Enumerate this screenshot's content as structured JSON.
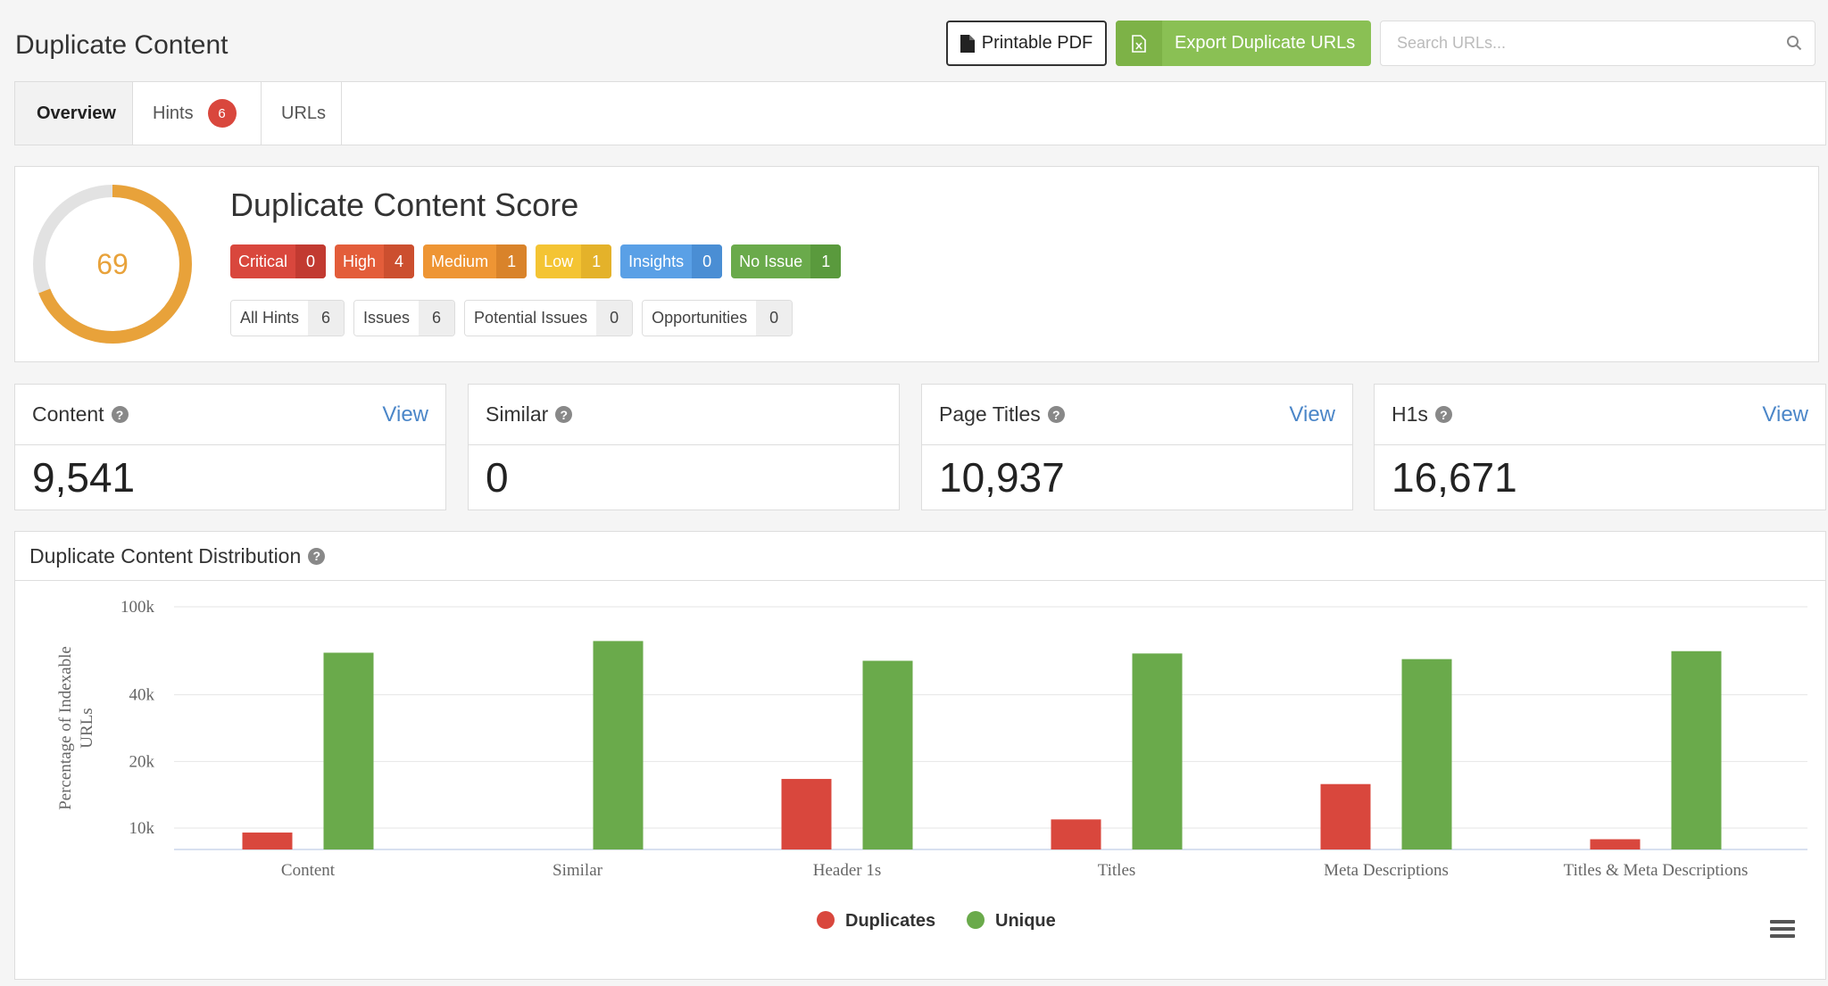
{
  "header": {
    "title": "Duplicate Content",
    "pdf_label": "Printable PDF",
    "export_label": "Export Duplicate URLs",
    "search_placeholder": "Search URLs..."
  },
  "tabs": [
    {
      "label": "Overview"
    },
    {
      "label": "Hints",
      "count": "6"
    },
    {
      "label": "URLs"
    }
  ],
  "score": {
    "title": "Duplicate Content Score",
    "value": "69",
    "fraction": 0.69,
    "ring_color": "#e8a23a",
    "severity": [
      {
        "label": "Critical",
        "count": "0",
        "color": "#d9473d",
        "count_bg": "#c23a31"
      },
      {
        "label": "High",
        "count": "4",
        "color": "#e35d3a",
        "count_bg": "#cc4f2f"
      },
      {
        "label": "Medium",
        "count": "1",
        "color": "#ee9534",
        "count_bg": "#d9832a"
      },
      {
        "label": "Low",
        "count": "1",
        "color": "#f4c433",
        "count_bg": "#e4b22a"
      },
      {
        "label": "Insights",
        "count": "0",
        "color": "#5aa0e6",
        "count_bg": "#4a8ed4"
      },
      {
        "label": "No Issue",
        "count": "1",
        "color": "#6aaa4b",
        "count_bg": "#5a9a3d"
      }
    ],
    "filters": [
      {
        "label": "All Hints",
        "count": "6"
      },
      {
        "label": "Issues",
        "count": "6"
      },
      {
        "label": "Potential Issues",
        "count": "0"
      },
      {
        "label": "Opportunities",
        "count": "0"
      }
    ]
  },
  "cards": [
    {
      "label": "Content",
      "value": "9,541",
      "view": "View"
    },
    {
      "label": "Similar",
      "value": "0",
      "view": ""
    },
    {
      "label": "Page Titles",
      "value": "10,937",
      "view": "View"
    },
    {
      "label": "H1s",
      "value": "16,671",
      "view": "View"
    }
  ],
  "distribution": {
    "title": "Duplicate Content Distribution"
  },
  "chart_data": {
    "type": "bar",
    "categories": [
      "Content",
      "Similar",
      "Header 1s",
      "Titles",
      "Meta Descriptions",
      "Titles & Meta Descriptions"
    ],
    "series": [
      {
        "name": "Duplicates",
        "color": "#d9473d",
        "values": [
          9541,
          0,
          16671,
          10937,
          15800,
          8900
        ]
      },
      {
        "name": "Unique",
        "color": "#6aaa4b",
        "values": [
          62000,
          70000,
          57000,
          61500,
          58000,
          63000
        ]
      }
    ],
    "ylabel": "Percentage of Indexable URLs",
    "yticks": [
      {
        "value": 10000,
        "label": "10k"
      },
      {
        "value": 20000,
        "label": "20k"
      },
      {
        "value": 40000,
        "label": "40k"
      },
      {
        "value": 100000,
        "label": "100k"
      }
    ],
    "ylim": [
      8000,
      100000
    ],
    "yscale": "log",
    "grid": true,
    "legend": "bottom-center"
  }
}
